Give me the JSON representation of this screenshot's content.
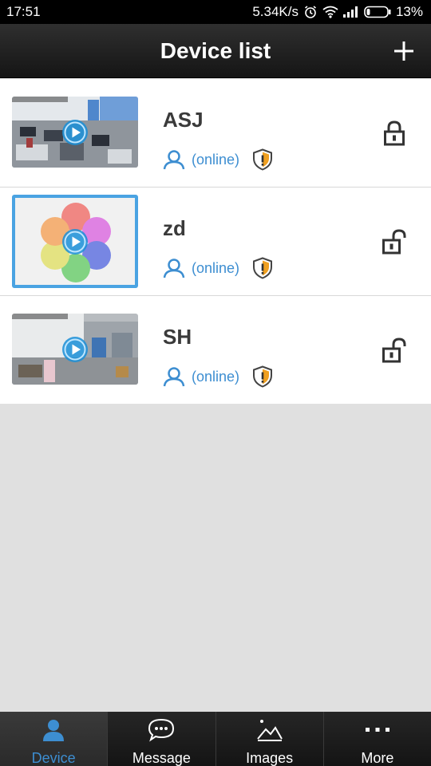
{
  "status_bar": {
    "time": "17:51",
    "speed": "5.34K/s",
    "battery": "13%",
    "icons": [
      "alarm-icon",
      "wifi-icon",
      "signal-icon",
      "battery-icon"
    ]
  },
  "header": {
    "title": "Device list",
    "add_icon": "plus-icon"
  },
  "devices": [
    {
      "name": "ASJ",
      "status": "(online)",
      "lock": "locked",
      "thumbnail": "office-camera-feed"
    },
    {
      "name": "zd",
      "status": "(online)",
      "lock": "unlocked",
      "thumbnail": "photos-app-flower"
    },
    {
      "name": "SH",
      "status": "(online)",
      "lock": "unlocked",
      "thumbnail": "workshop-camera-feed"
    }
  ],
  "tabs": [
    {
      "label": "Device",
      "icon": "person-icon",
      "active": true
    },
    {
      "label": "Message",
      "icon": "chat-bubble-icon",
      "active": false
    },
    {
      "label": "Images",
      "icon": "mountain-image-icon",
      "active": false
    },
    {
      "label": "More",
      "icon": "ellipsis-icon",
      "active": false
    }
  ],
  "colors": {
    "accent": "#3d8ed1",
    "shield_warning": "#f0a020",
    "title_bar": "#1f1f1f",
    "background": "#e0e0e0"
  }
}
